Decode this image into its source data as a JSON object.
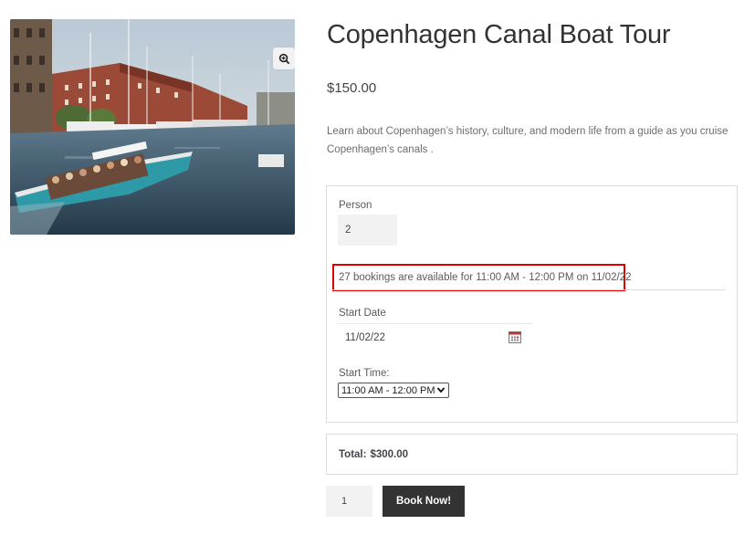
{
  "product": {
    "title": "Copenhagen Canal Boat Tour",
    "price": "$150.00",
    "description": "Learn about Copenhagen’s history, culture, and modern life from a guide as you cruise Copenhagen’s canals .",
    "image_icon": "zoom-in-icon"
  },
  "booking": {
    "person_label": "Person",
    "person_value": "2",
    "availability_text": "27 bookings are available for 11:00 AM - 12:00 PM on 11/02/22",
    "start_date_label": "Start Date",
    "start_date_value": "11/02/22",
    "calendar_icon": "calendar-icon",
    "start_time_label": "Start Time:",
    "start_time_selected": "11:00 AM - 12:00 PM"
  },
  "total": {
    "label": "Total:",
    "value": "$300.00"
  },
  "cart": {
    "quantity": "1",
    "book_button_label": "Book Now!"
  },
  "colors": {
    "highlight_border": "#e00000",
    "button_bg": "#333333",
    "input_bg": "#f2f2f2"
  }
}
